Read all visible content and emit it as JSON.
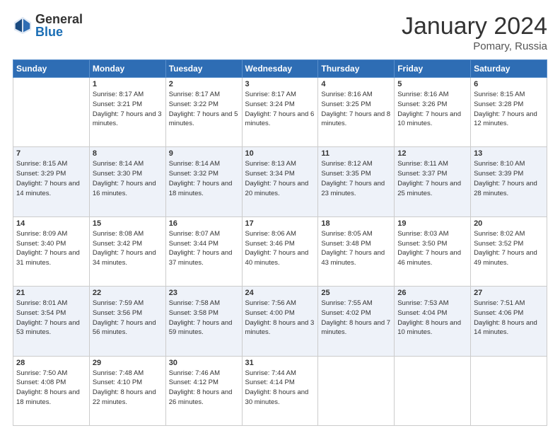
{
  "header": {
    "logo_general": "General",
    "logo_blue": "Blue",
    "month_title": "January 2024",
    "location": "Pomary, Russia"
  },
  "weekdays": [
    "Sunday",
    "Monday",
    "Tuesday",
    "Wednesday",
    "Thursday",
    "Friday",
    "Saturday"
  ],
  "weeks": [
    [
      {
        "day": "",
        "sunrise": "",
        "sunset": "",
        "daylight": ""
      },
      {
        "day": "1",
        "sunrise": "Sunrise: 8:17 AM",
        "sunset": "Sunset: 3:21 PM",
        "daylight": "Daylight: 7 hours and 3 minutes."
      },
      {
        "day": "2",
        "sunrise": "Sunrise: 8:17 AM",
        "sunset": "Sunset: 3:22 PM",
        "daylight": "Daylight: 7 hours and 5 minutes."
      },
      {
        "day": "3",
        "sunrise": "Sunrise: 8:17 AM",
        "sunset": "Sunset: 3:24 PM",
        "daylight": "Daylight: 7 hours and 6 minutes."
      },
      {
        "day": "4",
        "sunrise": "Sunrise: 8:16 AM",
        "sunset": "Sunset: 3:25 PM",
        "daylight": "Daylight: 7 hours and 8 minutes."
      },
      {
        "day": "5",
        "sunrise": "Sunrise: 8:16 AM",
        "sunset": "Sunset: 3:26 PM",
        "daylight": "Daylight: 7 hours and 10 minutes."
      },
      {
        "day": "6",
        "sunrise": "Sunrise: 8:15 AM",
        "sunset": "Sunset: 3:28 PM",
        "daylight": "Daylight: 7 hours and 12 minutes."
      }
    ],
    [
      {
        "day": "7",
        "sunrise": "",
        "sunset": "",
        "daylight": ""
      },
      {
        "day": "8",
        "sunrise": "Sunrise: 8:14 AM",
        "sunset": "Sunset: 3:30 PM",
        "daylight": "Daylight: 7 hours and 16 minutes."
      },
      {
        "day": "9",
        "sunrise": "Sunrise: 8:14 AM",
        "sunset": "Sunset: 3:32 PM",
        "daylight": "Daylight: 7 hours and 18 minutes."
      },
      {
        "day": "10",
        "sunrise": "Sunrise: 8:13 AM",
        "sunset": "Sunset: 3:34 PM",
        "daylight": "Daylight: 7 hours and 20 minutes."
      },
      {
        "day": "11",
        "sunrise": "Sunrise: 8:12 AM",
        "sunset": "Sunset: 3:35 PM",
        "daylight": "Daylight: 7 hours and 23 minutes."
      },
      {
        "day": "12",
        "sunrise": "Sunrise: 8:11 AM",
        "sunset": "Sunset: 3:37 PM",
        "daylight": "Daylight: 7 hours and 25 minutes."
      },
      {
        "day": "13",
        "sunrise": "Sunrise: 8:10 AM",
        "sunset": "Sunset: 3:39 PM",
        "daylight": "Daylight: 7 hours and 28 minutes."
      }
    ],
    [
      {
        "day": "14",
        "sunrise": "Sunrise: 8:09 AM",
        "sunset": "Sunset: 3:40 PM",
        "daylight": "Daylight: 7 hours and 31 minutes."
      },
      {
        "day": "15",
        "sunrise": "Sunrise: 8:08 AM",
        "sunset": "Sunset: 3:42 PM",
        "daylight": "Daylight: 7 hours and 34 minutes."
      },
      {
        "day": "16",
        "sunrise": "Sunrise: 8:07 AM",
        "sunset": "Sunset: 3:44 PM",
        "daylight": "Daylight: 7 hours and 37 minutes."
      },
      {
        "day": "17",
        "sunrise": "Sunrise: 8:06 AM",
        "sunset": "Sunset: 3:46 PM",
        "daylight": "Daylight: 7 hours and 40 minutes."
      },
      {
        "day": "18",
        "sunrise": "Sunrise: 8:05 AM",
        "sunset": "Sunset: 3:48 PM",
        "daylight": "Daylight: 7 hours and 43 minutes."
      },
      {
        "day": "19",
        "sunrise": "Sunrise: 8:03 AM",
        "sunset": "Sunset: 3:50 PM",
        "daylight": "Daylight: 7 hours and 46 minutes."
      },
      {
        "day": "20",
        "sunrise": "Sunrise: 8:02 AM",
        "sunset": "Sunset: 3:52 PM",
        "daylight": "Daylight: 7 hours and 49 minutes."
      }
    ],
    [
      {
        "day": "21",
        "sunrise": "Sunrise: 8:01 AM",
        "sunset": "Sunset: 3:54 PM",
        "daylight": "Daylight: 7 hours and 53 minutes."
      },
      {
        "day": "22",
        "sunrise": "Sunrise: 7:59 AM",
        "sunset": "Sunset: 3:56 PM",
        "daylight": "Daylight: 7 hours and 56 minutes."
      },
      {
        "day": "23",
        "sunrise": "Sunrise: 7:58 AM",
        "sunset": "Sunset: 3:58 PM",
        "daylight": "Daylight: 7 hours and 59 minutes."
      },
      {
        "day": "24",
        "sunrise": "Sunrise: 7:56 AM",
        "sunset": "Sunset: 4:00 PM",
        "daylight": "Daylight: 8 hours and 3 minutes."
      },
      {
        "day": "25",
        "sunrise": "Sunrise: 7:55 AM",
        "sunset": "Sunset: 4:02 PM",
        "daylight": "Daylight: 8 hours and 7 minutes."
      },
      {
        "day": "26",
        "sunrise": "Sunrise: 7:53 AM",
        "sunset": "Sunset: 4:04 PM",
        "daylight": "Daylight: 8 hours and 10 minutes."
      },
      {
        "day": "27",
        "sunrise": "Sunrise: 7:51 AM",
        "sunset": "Sunset: 4:06 PM",
        "daylight": "Daylight: 8 hours and 14 minutes."
      }
    ],
    [
      {
        "day": "28",
        "sunrise": "Sunrise: 7:50 AM",
        "sunset": "Sunset: 4:08 PM",
        "daylight": "Daylight: 8 hours and 18 minutes."
      },
      {
        "day": "29",
        "sunrise": "Sunrise: 7:48 AM",
        "sunset": "Sunset: 4:10 PM",
        "daylight": "Daylight: 8 hours and 22 minutes."
      },
      {
        "day": "30",
        "sunrise": "Sunrise: 7:46 AM",
        "sunset": "Sunset: 4:12 PM",
        "daylight": "Daylight: 8 hours and 26 minutes."
      },
      {
        "day": "31",
        "sunrise": "Sunrise: 7:44 AM",
        "sunset": "Sunset: 4:14 PM",
        "daylight": "Daylight: 8 hours and 30 minutes."
      },
      {
        "day": "",
        "sunrise": "",
        "sunset": "",
        "daylight": ""
      },
      {
        "day": "",
        "sunrise": "",
        "sunset": "",
        "daylight": ""
      },
      {
        "day": "",
        "sunrise": "",
        "sunset": "",
        "daylight": ""
      }
    ]
  ],
  "week7_sunday": {
    "sunrise": "Sunrise: 8:15 AM",
    "sunset": "Sunset: 3:29 PM",
    "daylight": "Daylight: 7 hours and 14 minutes."
  }
}
